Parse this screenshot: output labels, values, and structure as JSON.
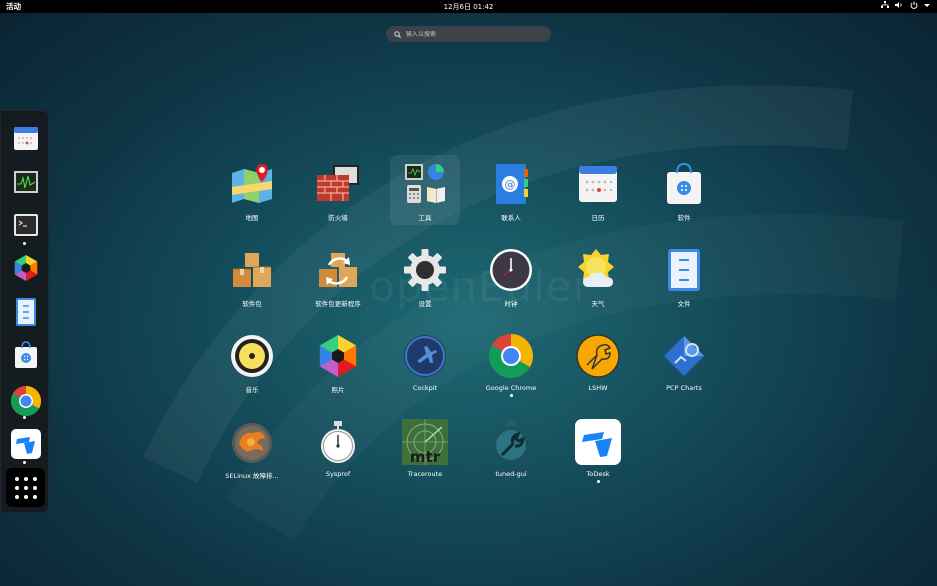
{
  "topbar": {
    "activities": "活动",
    "clock": "12月6日  01:42",
    "tray_icons": [
      "network-icon",
      "volume-icon",
      "power-icon",
      "chevron-down-icon"
    ]
  },
  "search": {
    "placeholder": "输入以搜索"
  },
  "watermark": "openEuler",
  "dash": {
    "items": [
      {
        "name": "calendar",
        "running": false
      },
      {
        "name": "system-monitor",
        "running": false
      },
      {
        "name": "terminal",
        "running": true
      },
      {
        "name": "photos",
        "running": false
      },
      {
        "name": "files",
        "running": false
      },
      {
        "name": "software",
        "running": false
      },
      {
        "name": "google-chrome",
        "running": true
      },
      {
        "name": "todesk",
        "running": true
      }
    ],
    "show_apps": "show-applications"
  },
  "apps": [
    {
      "label": "地图",
      "icon": "maps-icon",
      "running": false
    },
    {
      "label": "防火墙",
      "icon": "firewall-icon",
      "running": false
    },
    {
      "label": "工具",
      "icon": "utilities-folder-icon",
      "running": false,
      "selected": true
    },
    {
      "label": "联系人",
      "icon": "contacts-icon",
      "running": false
    },
    {
      "label": "日历",
      "icon": "calendar-icon",
      "running": false
    },
    {
      "label": "软件",
      "icon": "software-icon",
      "running": false
    },
    {
      "label": "软件包",
      "icon": "packages-icon",
      "running": false
    },
    {
      "label": "软件包更新程序",
      "icon": "package-updater-icon",
      "running": false
    },
    {
      "label": "设置",
      "icon": "settings-icon",
      "running": false
    },
    {
      "label": "时钟",
      "icon": "clock-icon",
      "running": false
    },
    {
      "label": "天气",
      "icon": "weather-icon",
      "running": false
    },
    {
      "label": "文件",
      "icon": "files-icon",
      "running": false
    },
    {
      "label": "音乐",
      "icon": "music-icon",
      "running": false
    },
    {
      "label": "照片",
      "icon": "photos-icon",
      "running": false
    },
    {
      "label": "Cockpit",
      "icon": "cockpit-icon",
      "running": false
    },
    {
      "label": "Google Chrome",
      "icon": "chrome-icon",
      "running": true
    },
    {
      "label": "LSHW",
      "icon": "lshw-icon",
      "running": false
    },
    {
      "label": "PCP Charts",
      "icon": "pcp-charts-icon",
      "running": false
    },
    {
      "label": "SELinux 故障排...",
      "icon": "selinux-icon",
      "running": false
    },
    {
      "label": "Sysprof",
      "icon": "sysprof-icon",
      "running": false
    },
    {
      "label": "Traceroute",
      "icon": "traceroute-icon",
      "running": false
    },
    {
      "label": "tuned-gui",
      "icon": "tuned-gui-icon",
      "running": false
    },
    {
      "label": "ToDesk",
      "icon": "todesk-icon",
      "running": true
    }
  ]
}
